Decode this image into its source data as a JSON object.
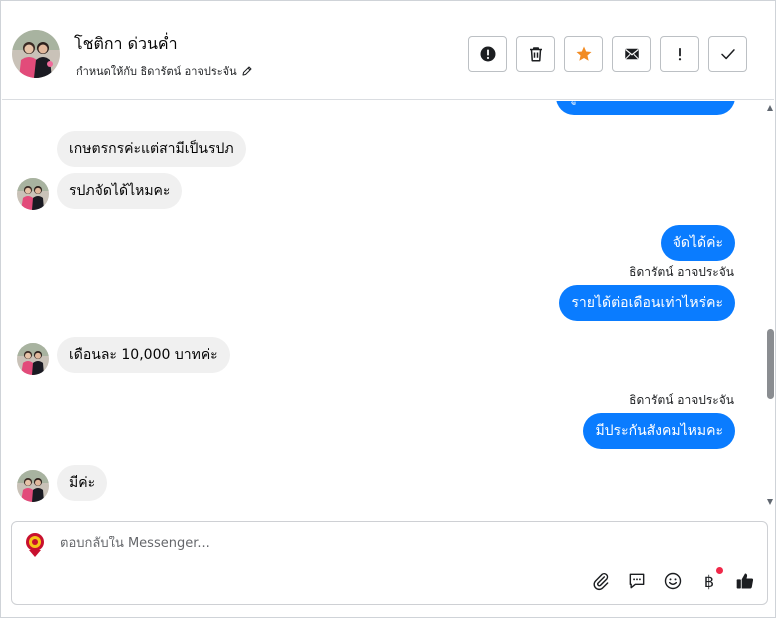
{
  "header": {
    "contact_name": "โชติกา ด่วนค่ำ",
    "assigned_text": "กำหนดให้กับ ธิดารัตน์ อาจประจัน",
    "toolbar_icons": [
      "alert-circle-icon",
      "trash-icon",
      "star-icon",
      "envelope-icon",
      "exclamation-icon",
      "check-icon"
    ],
    "star_color": "#f28b22"
  },
  "messages": [
    {
      "dir": "out",
      "text": "ผู้ทดลองการทำงานเกษตร"
    },
    {
      "dir": "in",
      "text": "เกษตรกรค่ะแต่สามีเป็นรปภ"
    },
    {
      "dir": "in",
      "text": "รปภจัดได้ไหมคะ"
    },
    {
      "dir": "out",
      "text": "จัดได้ค่ะ"
    },
    {
      "dir": "out",
      "sender": "ธิดารัตน์ อาจประจัน",
      "text": "รายได้ต่อเดือนเท่าไหร่คะ"
    },
    {
      "dir": "in",
      "text": "เดือนละ 10,000 บาทค่ะ"
    },
    {
      "dir": "out",
      "sender": "ธิดารัตน์ อาจประจัน",
      "text": "มีประกันสังคมไหมคะ"
    },
    {
      "dir": "in",
      "text": "มีค่ะ"
    }
  ],
  "composer": {
    "placeholder": "ตอบกลับใน Messenger...",
    "tools": [
      "paperclip-icon",
      "comment-icon",
      "emoji-icon",
      "baht-icon",
      "thumbs-up-icon"
    ],
    "baht_symbol": "฿",
    "notification_color": "#f02849"
  },
  "colors": {
    "outgoing_bubble": "#0a7cff",
    "incoming_bubble": "#f0f0f0"
  }
}
